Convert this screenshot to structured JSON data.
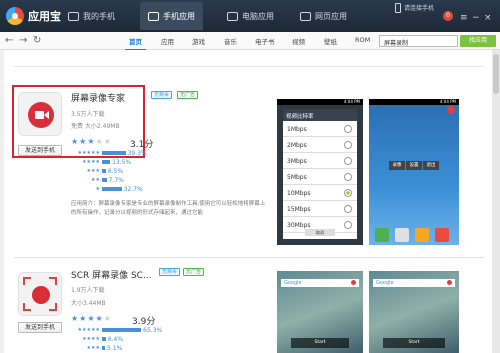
{
  "app": {
    "name": "应用宝"
  },
  "topnav": {
    "tabs": [
      "我的手机",
      "手机应用",
      "电脑应用",
      "网页应用"
    ],
    "active": 1,
    "badge": "0",
    "status": "请连接手机"
  },
  "navbar": {
    "categories": [
      "首页",
      "应用",
      "游戏",
      "音乐",
      "电子书",
      "视频",
      "壁纸",
      "ROM"
    ],
    "active_category": 0,
    "search_value": "屏幕录制",
    "search_button": "找应用"
  },
  "apps": [
    {
      "name": "屏幕录像专家",
      "downloads": "3.5万人下载",
      "meta": "免费 大小2.49MB",
      "tags": [
        "无病毒",
        "无广告"
      ],
      "score": "3.1分",
      "rating": 3.1,
      "send_button": "发送到手机",
      "breakdown": [
        {
          "stars": "★★★★★",
          "pct": 39.3,
          "label": "39.3%"
        },
        {
          "stars": "★★★★",
          "pct": 13.5,
          "label": "13.5%"
        },
        {
          "stars": "★★★",
          "pct": 6.5,
          "label": "6.5%"
        },
        {
          "stars": "★★",
          "pct": 7.7,
          "label": "7.7%"
        },
        {
          "stars": "★",
          "pct": 32.7,
          "label": "32.7%"
        }
      ],
      "description": "应用简介：屏幕录像专家是专业的屏幕录像制作工具,使用它可以轻松地将屏幕上的所有操作，记录分以视频的形式存储起来，通过它能",
      "screens": [
        {
          "statusbar": "4:04 PM",
          "dialog_title": "视频比特率",
          "options": [
            "1Mbps",
            "2Mbps",
            "3Mbps",
            "5Mbps",
            "10Mbps",
            "15Mbps",
            "30Mbps"
          ],
          "selected_option": 4,
          "cancel": "取消"
        },
        {
          "statusbar": "4:04 PM",
          "buttons": [
            "录像",
            "设置",
            "退出"
          ]
        }
      ]
    },
    {
      "name": "SCR 屏幕录像 SC...",
      "downloads": "1.9万人下载",
      "meta": "大小3.44MB",
      "tags": [
        "无病毒",
        "无广告"
      ],
      "score": "3.9分",
      "rating": 3.9,
      "send_button": "发送到手机",
      "breakdown": [
        {
          "stars": "★★★★★",
          "pct": 65.3,
          "label": "65.3%"
        },
        {
          "stars": "★★★★",
          "pct": 6.4,
          "label": "6.4%"
        },
        {
          "stars": "★★★",
          "pct": 5.1,
          "label": "5.1%"
        }
      ],
      "screens": [
        {
          "search": "Google",
          "control": "Start"
        },
        {
          "search": "Google",
          "control": "Start"
        }
      ]
    }
  ]
}
